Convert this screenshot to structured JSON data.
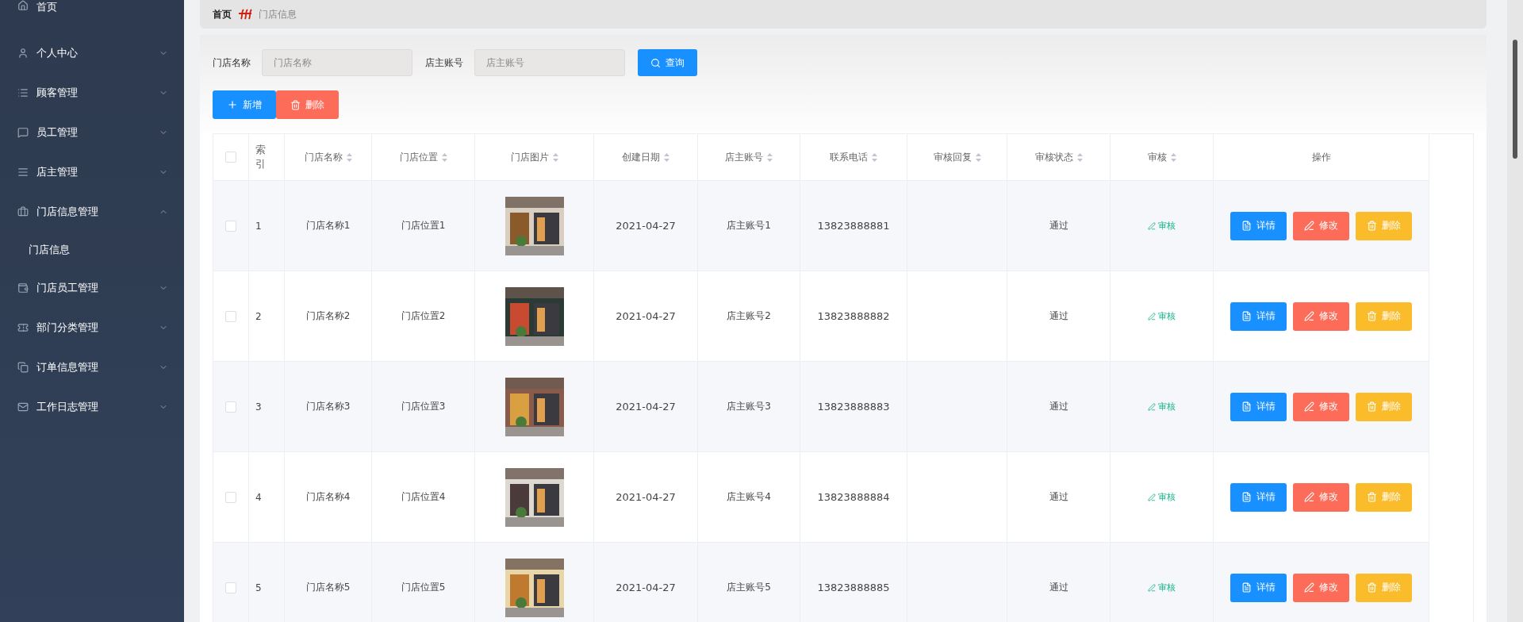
{
  "sidebar": {
    "items": [
      {
        "label": "首页",
        "kind": "link"
      },
      {
        "label": "个人中心",
        "kind": "menu",
        "expanded": false
      },
      {
        "label": "顾客管理",
        "kind": "menu",
        "expanded": false
      },
      {
        "label": "员工管理",
        "kind": "menu",
        "expanded": false
      },
      {
        "label": "店主管理",
        "kind": "menu",
        "expanded": false
      },
      {
        "label": "门店信息管理",
        "kind": "menu",
        "expanded": true,
        "children": [
          {
            "label": "门店信息",
            "selected": true
          }
        ]
      },
      {
        "label": "门店员工管理",
        "kind": "menu",
        "expanded": false
      },
      {
        "label": "部门分类管理",
        "kind": "menu",
        "expanded": false
      },
      {
        "label": "订单信息管理",
        "kind": "menu",
        "expanded": false
      },
      {
        "label": "工作日志管理",
        "kind": "menu",
        "expanded": false
      }
    ]
  },
  "breadcrumb": [
    "首页",
    "门店信息"
  ],
  "search": {
    "fields": [
      {
        "label": "门店名称",
        "placeholder": "门店名称"
      },
      {
        "label": "店主账号",
        "placeholder": "店主账号"
      }
    ],
    "button": "查询"
  },
  "toolbar": [
    {
      "label": "新增",
      "kind": "add"
    },
    {
      "label": "删除",
      "kind": "delete"
    }
  ],
  "table": {
    "columns": [
      {
        "kind": "check",
        "checked": false
      },
      {
        "label": "索引",
        "kind": "index",
        "sortable": false
      },
      {
        "label": "门店名称",
        "sortable": true
      },
      {
        "label": "门店位置",
        "sortable": true
      },
      {
        "label": "门店图片",
        "sortable": true
      },
      {
        "label": "创建日期",
        "sortable": true
      },
      {
        "label": "店主账号",
        "sortable": true
      },
      {
        "label": "联系电话",
        "sortable": true
      },
      {
        "label": "审核回复",
        "sortable": true
      },
      {
        "label": "审核状态",
        "sortable": true
      },
      {
        "label": "审核",
        "sortable": true
      },
      {
        "label": "操作",
        "sortable": false
      }
    ],
    "rows": [
      {
        "checked": false,
        "index": "1",
        "name": "门店名称1",
        "location": "门店位置1",
        "date": "2021-04-27",
        "owner": "店主账号1",
        "phone": "13823888881",
        "status": "通过",
        "review": "审核",
        "actions": [
          {
            "label": "详情",
            "kind": "detail"
          },
          {
            "label": "修改",
            "kind": "edit"
          },
          {
            "label": "删除",
            "kind": "delete"
          }
        ]
      },
      {
        "checked": false,
        "index": "2",
        "name": "门店名称2",
        "location": "门店位置2",
        "date": "2021-04-27",
        "owner": "店主账号2",
        "phone": "13823888882",
        "status": "通过",
        "review": "审核",
        "actions": [
          {
            "label": "详情",
            "kind": "detail"
          },
          {
            "label": "修改",
            "kind": "edit"
          },
          {
            "label": "删除",
            "kind": "delete"
          }
        ]
      },
      {
        "checked": false,
        "index": "3",
        "name": "门店名称3",
        "location": "门店位置3",
        "date": "2021-04-27",
        "owner": "店主账号3",
        "phone": "13823888883",
        "status": "通过",
        "review": "审核",
        "actions": [
          {
            "label": "详情",
            "kind": "detail"
          },
          {
            "label": "修改",
            "kind": "edit"
          },
          {
            "label": "删除",
            "kind": "delete"
          }
        ]
      },
      {
        "checked": false,
        "index": "4",
        "name": "门店名称4",
        "location": "门店位置4",
        "date": "2021-04-27",
        "owner": "店主账号4",
        "phone": "13823888884",
        "status": "通过",
        "review": "审核",
        "actions": [
          {
            "label": "详情",
            "kind": "detail"
          },
          {
            "label": "修改",
            "kind": "edit"
          },
          {
            "label": "删除",
            "kind": "delete"
          }
        ]
      },
      {
        "checked": false,
        "index": "5",
        "name": "门店名称5",
        "location": "门店位置5",
        "date": "2021-04-27",
        "owner": "店主账号5",
        "phone": "13823888885",
        "status": "通过",
        "review": "审核",
        "actions": [
          {
            "label": "详情",
            "kind": "detail"
          },
          {
            "label": "修改",
            "kind": "edit"
          },
          {
            "label": "删除",
            "kind": "delete"
          }
        ]
      }
    ]
  }
}
